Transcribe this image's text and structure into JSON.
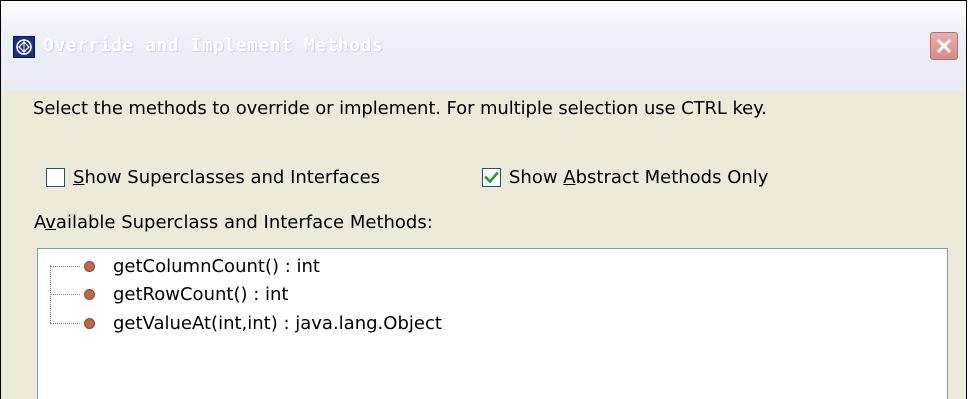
{
  "window": {
    "title": "Override and Implement Methods",
    "title_icon": "eclipse-icon",
    "close_icon": "close-icon"
  },
  "instruction": "Select the methods to override or implement. For multiple selection use CTRL key.",
  "options": {
    "show_superclasses": {
      "pre": "",
      "accel": "S",
      "post": "how Superclasses and Interfaces",
      "checked": false
    },
    "show_abstract": {
      "pre": "Show ",
      "accel": "A",
      "post": "bstract Methods Only",
      "checked": true
    }
  },
  "methods_label": {
    "pre": "A",
    "accel": "v",
    "post": "ailable Superclass and Interface Methods:"
  },
  "methods": [
    "getColumnCount() : int",
    "getRowCount() : int",
    "getValueAt(int,int) : java.lang.Object"
  ],
  "colors": {
    "dialog_bg": "#ece9d8",
    "title_gradient": "#fcfcfe",
    "method_dot": "#c0684a",
    "checkbox_border": "#1c5180",
    "checkmark": "#21a121",
    "close_button": "#d88a8a"
  }
}
